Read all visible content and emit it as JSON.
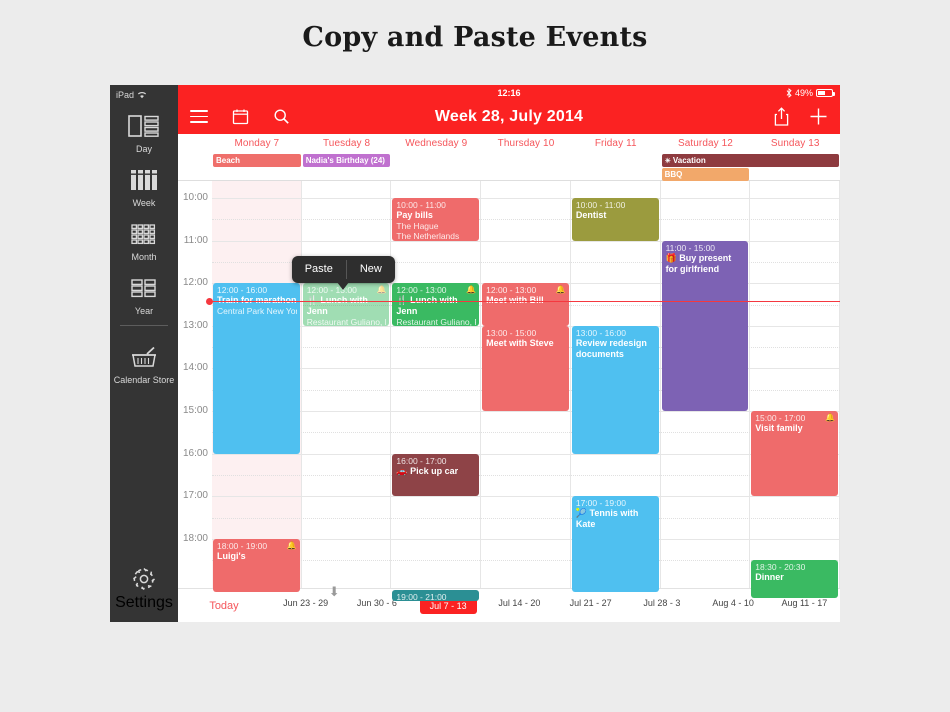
{
  "page": {
    "title": "Copy and Paste Events"
  },
  "device": {
    "status": {
      "device_label": "iPad",
      "wifi_icon": "wifi-icon",
      "time": "12:16",
      "bluetooth_icon": "bluetooth-icon",
      "battery_percent": "49%"
    },
    "navbar": {
      "title": "Week 28, July 2014",
      "menu_icon": "hamburger-icon",
      "calendar_icon": "calendar-icon",
      "search_icon": "search-icon",
      "share_icon": "share-icon",
      "add_icon": "plus-icon"
    }
  },
  "sidebar": {
    "items": [
      {
        "label": "Day",
        "icon": "day-view-icon"
      },
      {
        "label": "Week",
        "icon": "week-view-icon"
      },
      {
        "label": "Month",
        "icon": "month-view-icon"
      },
      {
        "label": "Year",
        "icon": "year-view-icon"
      },
      {
        "label": "Calendar Store",
        "icon": "store-icon"
      }
    ],
    "settings": {
      "label": "Settings",
      "icon": "gear-icon"
    }
  },
  "calendar": {
    "days": [
      "Monday 7",
      "Tuesday 8",
      "Wednesday 9",
      "Thursday 10",
      "Friday 11",
      "Saturday 12",
      "Sunday 13"
    ],
    "time_labels": [
      "10:00",
      "11:00",
      "12:00",
      "13:00",
      "14:00",
      "15:00",
      "16:00",
      "17:00",
      "18:00"
    ],
    "today_column_index": 0,
    "now_time": "12:25",
    "allday_events": [
      {
        "title": "Beach",
        "day": 0,
        "span": 1,
        "color": "#ef6f6b",
        "icon": ""
      },
      {
        "title": "Nadia's Birthday (24)",
        "day": 1,
        "span": 1,
        "color": "#c071cf",
        "icon": ""
      },
      {
        "title": "Vacation",
        "day": 5,
        "span": 2,
        "color": "#8e3b3f",
        "icon": "☀",
        "row": 0
      },
      {
        "title": "BBQ",
        "day": 5,
        "span": 1,
        "color": "#f2a86a",
        "icon": "",
        "row": 1
      }
    ],
    "events": [
      {
        "time": "12:00 - 16:00",
        "name": "Train for marathon",
        "location": "Central Park New York",
        "day": 0,
        "color": "#4fc0f0",
        "start": 12.0,
        "end": 16.0,
        "icon": "recurring-icon",
        "alarm": false
      },
      {
        "time": "10:00 - 11:00",
        "name": "Pay bills",
        "location": "The Hague\nThe Netherlands",
        "day": 2,
        "color": "#ef6b6b",
        "start": 10.0,
        "end": 11.0,
        "icon": "",
        "alarm": false
      },
      {
        "time": "12:00 - 13:00",
        "name": "Lunch with Jenn",
        "location": "Restaurant Guliano, R",
        "day": 1,
        "color": "#3aba62",
        "start": 12.0,
        "end": 13.0,
        "icon": "🍴",
        "alarm": true,
        "ghost": true
      },
      {
        "time": "12:00 - 13:00",
        "name": "Lunch with Jenn",
        "location": "Restaurant Guliano, R",
        "day": 2,
        "color": "#3aba62",
        "start": 12.0,
        "end": 13.0,
        "icon": "🍴",
        "alarm": true
      },
      {
        "time": "12:00 - 13:00",
        "name": "Meet with Bill",
        "location": "",
        "day": 3,
        "color": "#ef6b6b",
        "start": 12.0,
        "end": 13.0,
        "icon": "",
        "alarm": true
      },
      {
        "time": "13:00 - 15:00",
        "name": "Meet with Steve",
        "location": "",
        "day": 3,
        "color": "#ef6b6b",
        "start": 13.0,
        "end": 15.0,
        "icon": "",
        "alarm": false
      },
      {
        "time": "10:00 - 11:00",
        "name": "Dentist",
        "location": "",
        "day": 4,
        "color": "#9b9b3e",
        "start": 10.0,
        "end": 11.0,
        "icon": "",
        "alarm": false
      },
      {
        "time": "13:00 - 16:00",
        "name": "Review redesign documents",
        "location": "",
        "day": 4,
        "color": "#4fc0f0",
        "start": 13.0,
        "end": 16.0,
        "icon": "",
        "alarm": false
      },
      {
        "time": "17:00 - 19:00",
        "name": "Tennis with Kate",
        "location": "",
        "day": 4,
        "color": "#4fc0f0",
        "start": 17.0,
        "end": 19.25,
        "icon": "🎾",
        "alarm": false
      },
      {
        "time": "11:00 - 15:00",
        "name": "Buy present for girlfriend",
        "location": "",
        "day": 5,
        "color": "#7d62b4",
        "start": 11.0,
        "end": 15.0,
        "icon": "🎁",
        "alarm": false
      },
      {
        "time": "16:00 - 17:00",
        "name": "Pick up car",
        "location": "",
        "day": 2,
        "color": "#8e4347",
        "start": 16.0,
        "end": 17.0,
        "icon": "🚗",
        "alarm": false
      },
      {
        "time": "15:00 - 17:00",
        "name": "Visit family",
        "location": "",
        "day": 6,
        "color": "#ef6b6b",
        "start": 15.0,
        "end": 17.0,
        "icon": "",
        "alarm": true
      },
      {
        "time": "18:00 - 19:00",
        "name": "Luigi's",
        "location": "",
        "day": 0,
        "color": "#ef6b6b",
        "start": 18.0,
        "end": 19.25,
        "icon": "",
        "alarm": true
      },
      {
        "time": "18:30 - 20:30",
        "name": "Dinner",
        "location": "",
        "day": 6,
        "color": "#3aba62",
        "start": 18.5,
        "end": 19.4,
        "icon": "",
        "alarm": false
      },
      {
        "time": "19:00 - 21:00",
        "name": "",
        "location": "",
        "day": 2,
        "color": "#2b8f94",
        "start": 19.2,
        "end": 19.45,
        "icon": "",
        "alarm": false
      }
    ]
  },
  "popup": {
    "paste_label": "Paste",
    "new_label": "New"
  },
  "bottombar": {
    "today_label": "Today",
    "weeks": [
      {
        "label": "Jun 23 - 29",
        "selected": false
      },
      {
        "label": "Jun 30 - 6",
        "selected": false
      },
      {
        "label": "Jul 7 - 13",
        "selected": true
      },
      {
        "label": "Jul 14 - 20",
        "selected": false
      },
      {
        "label": "Jul 21 - 27",
        "selected": false
      },
      {
        "label": "Jul 28 - 3",
        "selected": false
      },
      {
        "label": "Aug 4 - 10",
        "selected": false
      },
      {
        "label": "Aug 11 - 17",
        "selected": false
      }
    ]
  },
  "colors": {
    "brand_red": "#fb2222",
    "accent_red": "#f5565b",
    "sidebar_bg": "#343434",
    "today_bg": "#fdf0f1"
  }
}
